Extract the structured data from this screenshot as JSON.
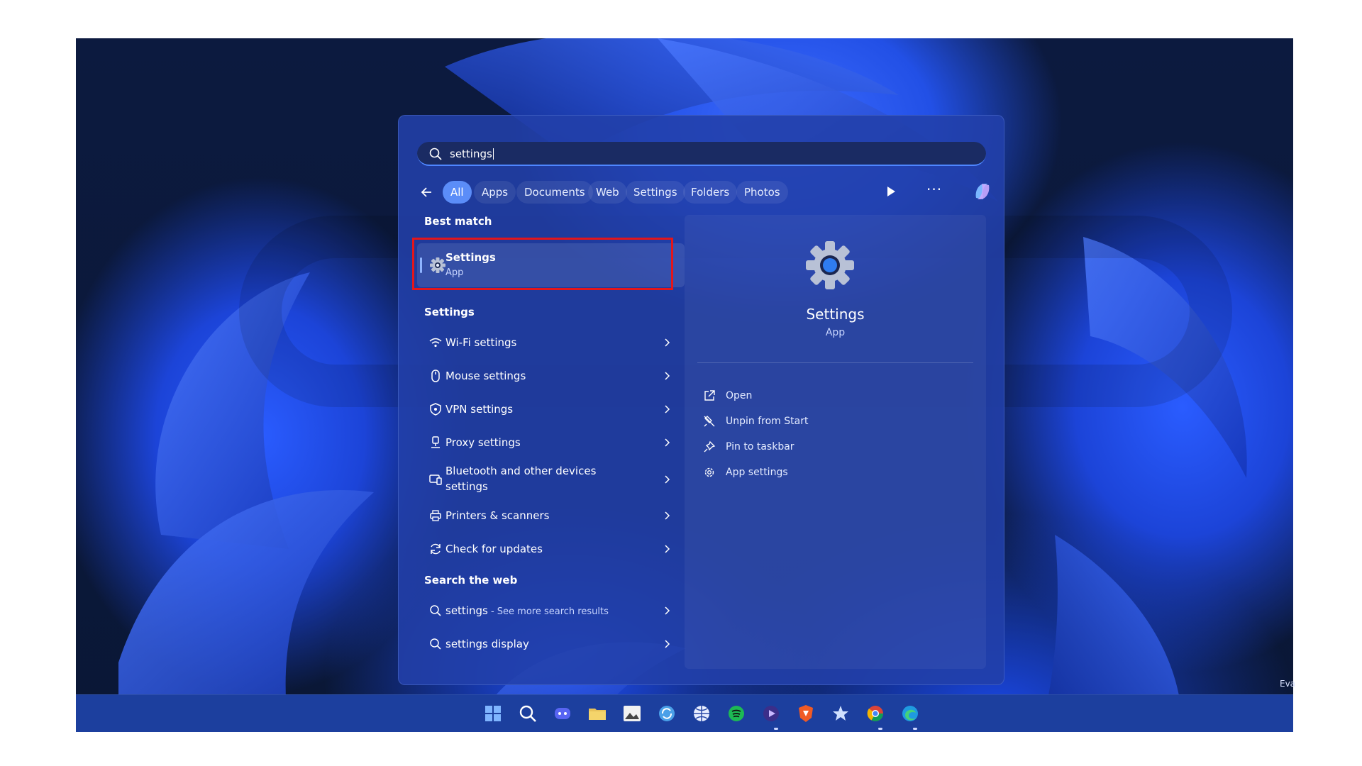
{
  "search": {
    "value": "settings"
  },
  "filters": {
    "chips": [
      "All",
      "Apps",
      "Documents",
      "Web",
      "Settings",
      "Folders",
      "Photos"
    ],
    "more": "···"
  },
  "best_match": {
    "heading": "Best match",
    "title": "Settings",
    "subtitle": "App"
  },
  "settings_section": {
    "heading": "Settings",
    "items": [
      {
        "label": "Wi-Fi settings",
        "icon": "wifi-icon"
      },
      {
        "label": "Mouse settings",
        "icon": "mouse-icon"
      },
      {
        "label": "VPN settings",
        "icon": "shield-icon"
      },
      {
        "label": "Proxy settings",
        "icon": "proxy-icon"
      },
      {
        "label": "Bluetooth and other devices settings",
        "icon": "devices-icon"
      },
      {
        "label": "Printers & scanners",
        "icon": "printer-icon"
      },
      {
        "label": "Check for updates",
        "icon": "refresh-icon"
      }
    ]
  },
  "web_section": {
    "heading": "Search the web",
    "items": [
      {
        "label": "settings",
        "sub": " - See more search results",
        "icon": "search-icon"
      },
      {
        "label": "settings display",
        "icon": "search-icon"
      }
    ]
  },
  "preview": {
    "title": "Settings",
    "kind": "App",
    "actions": [
      {
        "label": "Open",
        "icon": "open-external-icon"
      },
      {
        "label": "Unpin from Start",
        "icon": "unpin-icon"
      },
      {
        "label": "Pin to taskbar",
        "icon": "pin-icon"
      },
      {
        "label": "App settings",
        "icon": "gear-icon"
      }
    ]
  },
  "corner_text": "Eva",
  "colors": {
    "accent": "#5b8df8",
    "highlight_box": "#e3161b",
    "panel": "#2240aa",
    "taskbar": "#1c3f9e"
  },
  "taskbar": {
    "icons": [
      "windows-start-icon",
      "search-icon",
      "discord-icon",
      "file-explorer-icon",
      "photos-icon",
      "sync-icon",
      "globe-icon",
      "spotify-icon",
      "media-player-icon",
      "brave-icon",
      "app-icon",
      "chrome-icon",
      "edge-icon"
    ]
  }
}
